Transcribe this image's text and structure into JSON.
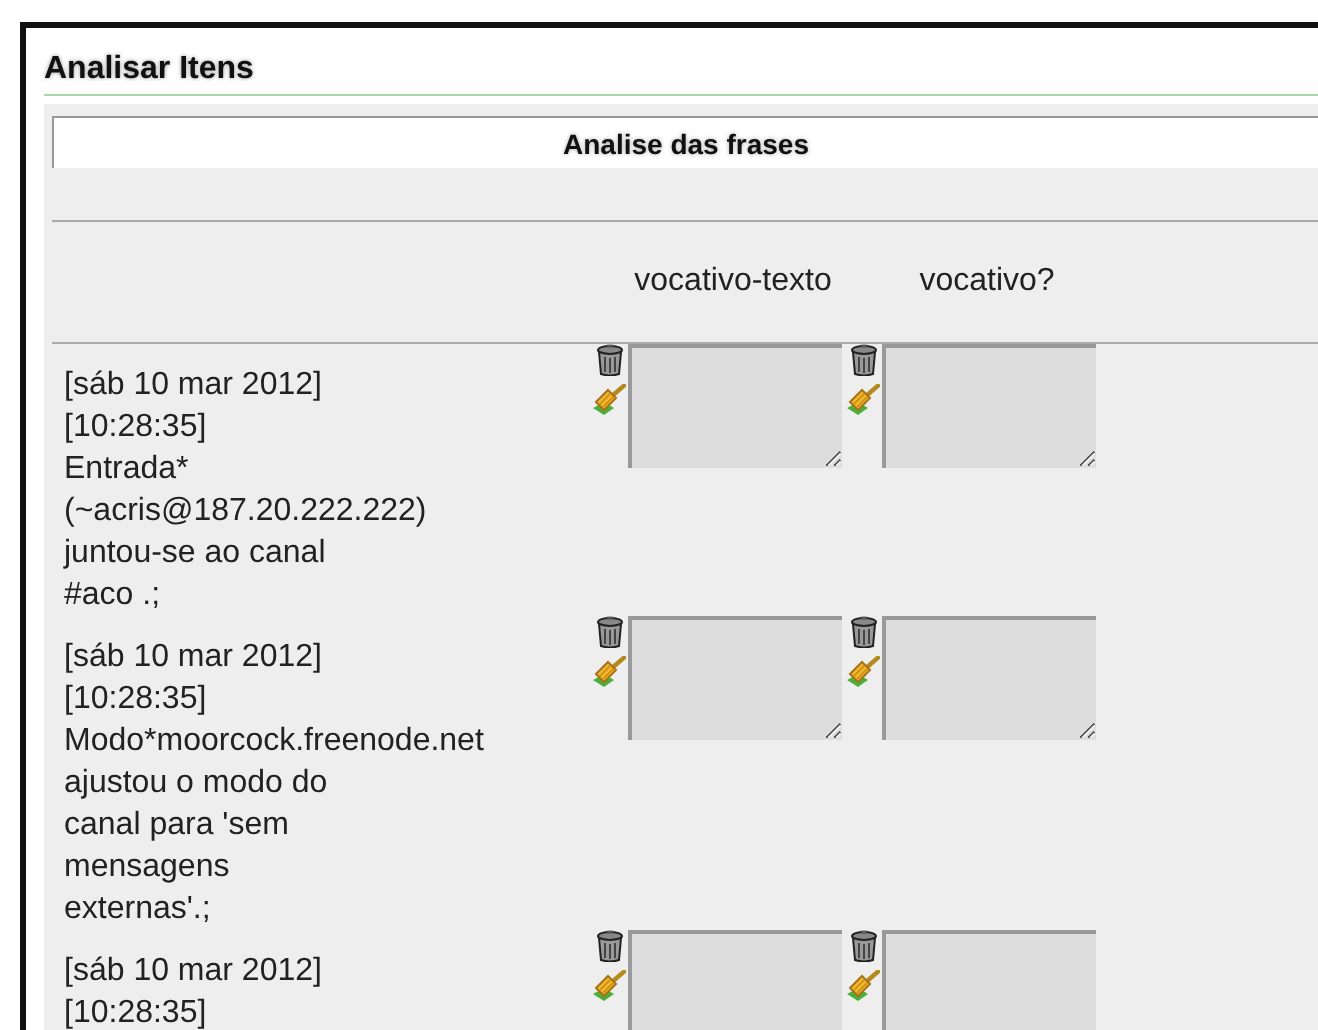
{
  "page": {
    "title": "Analisar Itens"
  },
  "table": {
    "caption": "Analise das frases",
    "columns": [
      "vocativo-texto",
      "vocativo?"
    ],
    "rows": [
      {
        "lines": [
          "[sáb 10 mar 2012]",
          "[10:28:35]",
          "Entrada*",
          "(~acris@187.20.222.222)",
          "juntou-se ao canal",
          "#aco .;"
        ]
      },
      {
        "lines": [
          "[sáb 10 mar 2012]",
          "[10:28:35]",
          "Modo*moorcock.freenode.net",
          "ajustou o modo do",
          "canal para 'sem",
          "mensagens",
          "externas'.;"
        ]
      },
      {
        "lines": [
          "[sáb 10 mar 2012]",
          "[10:28:35]"
        ]
      }
    ]
  }
}
